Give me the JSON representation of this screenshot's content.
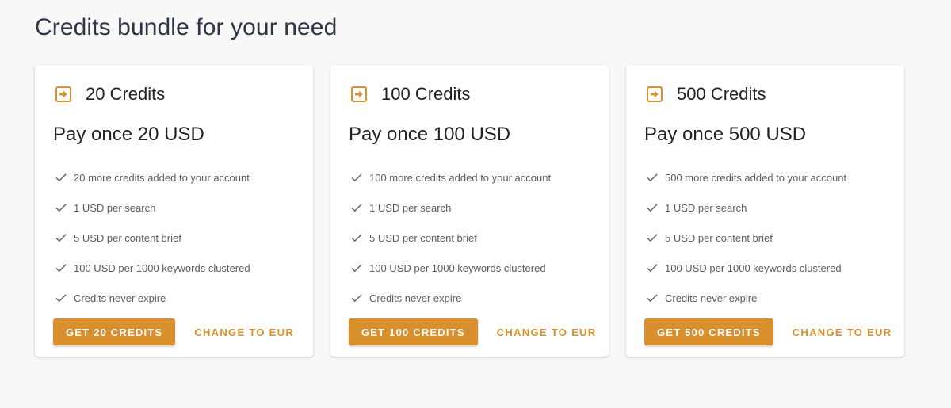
{
  "page": {
    "title": "Credits bundle for your need"
  },
  "colors": {
    "accent": "#d98f2c",
    "check": "#666666"
  },
  "cards": [
    {
      "title": "20 Credits",
      "price": "Pay once 20 USD",
      "features": [
        "20 more credits added to your account",
        "1 USD per search",
        "5 USD per content brief",
        "100 USD per 1000 keywords clustered",
        "Credits never expire"
      ],
      "primary_button": "GET 20 CREDITS",
      "secondary_button": "CHANGE TO EUR"
    },
    {
      "title": "100 Credits",
      "price": "Pay once 100 USD",
      "features": [
        "100 more credits added to your account",
        "1 USD per search",
        "5 USD per content brief",
        "100 USD per 1000 keywords clustered",
        "Credits never expire"
      ],
      "primary_button": "GET 100 CREDITS",
      "secondary_button": "CHANGE TO EUR"
    },
    {
      "title": "500 Credits",
      "price": "Pay once 500 USD",
      "features": [
        "500 more credits added to your account",
        "1 USD per search",
        "5 USD per content brief",
        "100 USD per 1000 keywords clustered",
        "Credits never expire"
      ],
      "primary_button": "GET 500 CREDITS",
      "secondary_button": "CHANGE TO EUR"
    }
  ]
}
